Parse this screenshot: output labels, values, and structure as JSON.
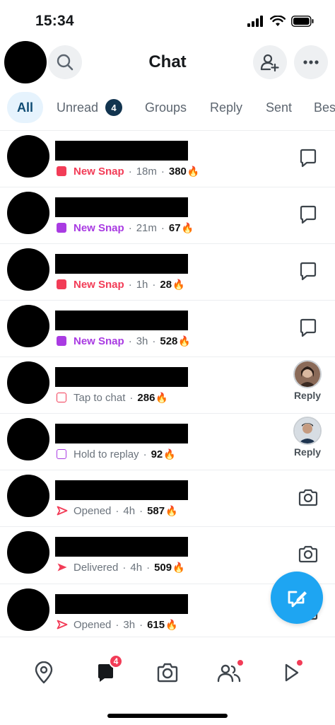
{
  "status_bar": {
    "time": "15:34"
  },
  "header": {
    "title": "Chat",
    "icons": [
      "search-icon",
      "add-friend-icon",
      "more-icon"
    ]
  },
  "tabs": [
    {
      "label": "All",
      "active": true
    },
    {
      "label": "Unread",
      "badge": "4"
    },
    {
      "label": "Groups"
    },
    {
      "label": "Reply"
    },
    {
      "label": "Sent"
    },
    {
      "label": "Bes"
    }
  ],
  "chats": [
    {
      "status": "New Snap",
      "status_color": "#f23c57",
      "square": "filled",
      "time": "18m",
      "streak": "380",
      "action": "chat-icon"
    },
    {
      "status": "New Snap",
      "status_color": "#a93be2",
      "square": "filled",
      "time": "21m",
      "streak": "67",
      "action": "chat-icon"
    },
    {
      "status": "New Snap",
      "status_color": "#f23c57",
      "square": "filled",
      "time": "1h",
      "streak": "28",
      "action": "chat-icon"
    },
    {
      "status": "New Snap",
      "status_color": "#a93be2",
      "square": "filled",
      "time": "3h",
      "streak": "528",
      "action": "chat-icon"
    },
    {
      "status": "Tap to chat",
      "status_color": "#f23c57",
      "square": "outline",
      "time": "",
      "streak": "286",
      "action": "reply",
      "action_label": "Reply"
    },
    {
      "status": "Hold to replay",
      "status_color": "#a93be2",
      "square": "outline",
      "time": "",
      "streak": "92",
      "action": "reply",
      "action_label": "Reply"
    },
    {
      "status": "Opened",
      "status_color": "#f23c57",
      "square": "arrow-outline",
      "time": "4h",
      "streak": "587",
      "action": "camera-icon"
    },
    {
      "status": "Delivered",
      "status_color": "#f23c57",
      "square": "arrow-filled",
      "time": "4h",
      "streak": "509",
      "action": "camera-icon"
    },
    {
      "status": "Opened",
      "status_color": "#f23c57",
      "square": "arrow-outline",
      "time": "3h",
      "streak": "615",
      "action": "camera-icon"
    }
  ],
  "bottom_nav": {
    "items": [
      "map-icon",
      "chat-nav-icon",
      "camera-nav-icon",
      "friends-icon",
      "spotlight-icon"
    ],
    "chat_badge": "4"
  },
  "colors": {
    "accent": "#1ea5f2",
    "red": "#f23c57",
    "purple": "#a93be2",
    "tab_active_bg": "#e6f3fd"
  }
}
